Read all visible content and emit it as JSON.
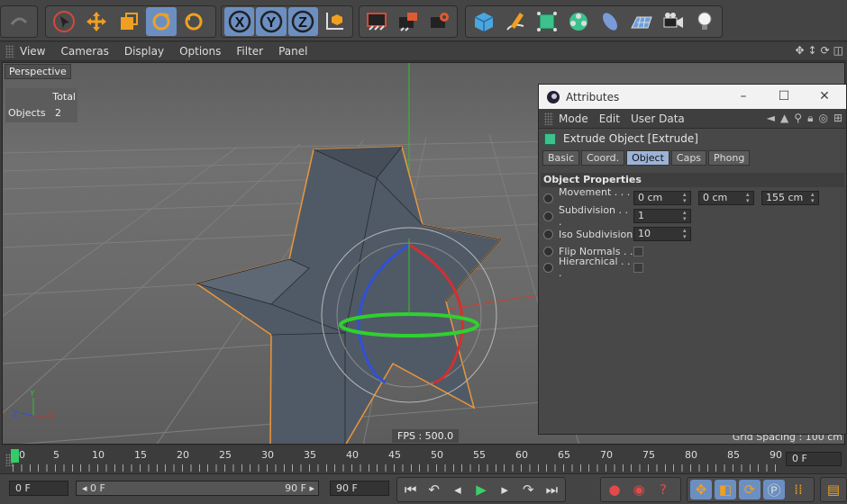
{
  "viewport_menu": [
    "View",
    "Cameras",
    "Display",
    "Options",
    "Filter",
    "Panel"
  ],
  "viewport": {
    "label": "Perspective",
    "hud_header": "Total",
    "hud_key": "Objects",
    "hud_value": "2",
    "fps": "FPS : 500.0",
    "grid_spacing": "Grid Spacing : 100 cm"
  },
  "attributes": {
    "title": "Attributes",
    "menu": [
      "Mode",
      "Edit",
      "User Data"
    ],
    "object_name": "Extrude Object [Extrude]",
    "tabs": [
      "Basic",
      "Coord.",
      "Object",
      "Caps",
      "Phong"
    ],
    "selected_tab": "Object",
    "section": "Object Properties",
    "movement_label": "Movement . . . .",
    "movement": [
      "0 cm",
      "0 cm",
      "155 cm"
    ],
    "subdivision_label": "Subdivision . . .",
    "subdivision": "1",
    "iso_label": "Iso Subdivision",
    "iso": "10",
    "flip_label": "Flip Normals . .",
    "hier_label": "Hierarchical . . ."
  },
  "timeline": {
    "numbers": [
      "0",
      "5",
      "10",
      "15",
      "20",
      "25",
      "30",
      "35",
      "40",
      "45",
      "50",
      "55",
      "60",
      "65",
      "70",
      "75",
      "80",
      "85",
      "90"
    ],
    "current_frame": "0 F"
  },
  "bottom": {
    "start": "0 F",
    "range_start": "◂ 0 F",
    "range_end": "90 F ▸",
    "end": "90 F"
  },
  "colors": {
    "accent": "#6c8fc2",
    "selection_outline": "#e8963c",
    "axis_x": "#d23030",
    "axis_y": "#30c030",
    "axis_z": "#3050d8"
  }
}
